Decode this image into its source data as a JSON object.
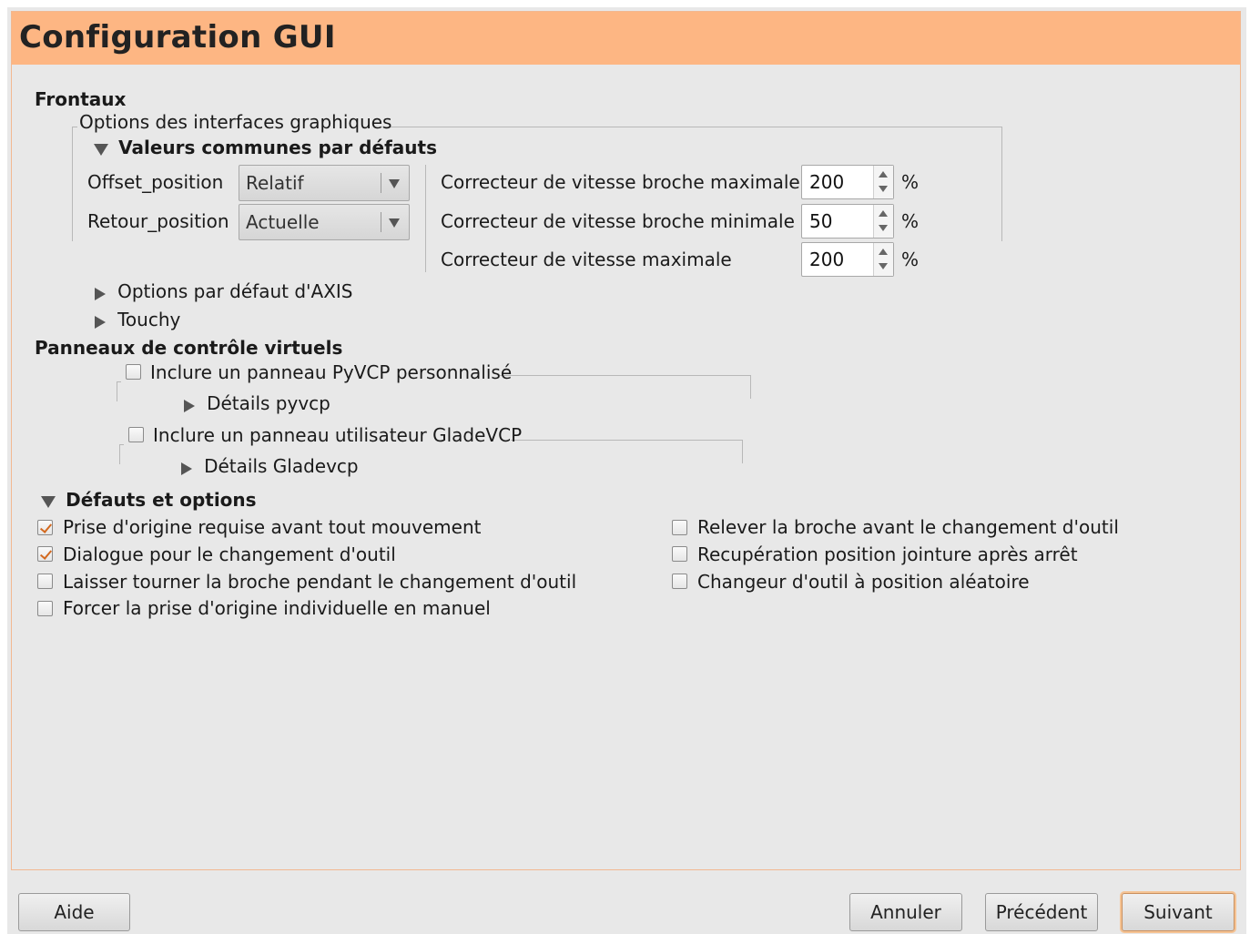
{
  "window": {
    "title": "Configuration GUI"
  },
  "frontaux": {
    "heading": "Frontaux",
    "frame_label": "Options des interfaces graphiques",
    "common_defaults": {
      "expander_label": "Valeurs communes par défauts",
      "offset_label": "Offset_position",
      "offset_value": "Relatif",
      "retour_label": "Retour_position",
      "retour_value": "Actuelle",
      "spindle_max_label": "Correcteur de vitesse broche maximale",
      "spindle_max_value": "200",
      "spindle_min_label": "Correcteur de vitesse broche minimale",
      "spindle_min_value": "50",
      "feed_max_label": "Correcteur de vitesse maximale",
      "feed_max_value": "200",
      "percent": "%"
    },
    "axis_label": "Options par défaut d'AXIS",
    "touchy_label": "Touchy"
  },
  "panneaux": {
    "heading": "Panneaux de contrôle virtuels",
    "pyvcp_label": "Inclure un panneau PyVCP personnalisé",
    "pyvcp_details": "Détails pyvcp",
    "glade_label": "Inclure un panneau utilisateur GladeVCP",
    "glade_details": "Détails Gladevcp"
  },
  "defaults": {
    "expander_label": "Défauts et options",
    "left": [
      {
        "label": "Prise d'origine requise avant tout mouvement",
        "checked": true
      },
      {
        "label": "Dialogue pour le changement d'outil",
        "checked": true
      },
      {
        "label": "Laisser tourner la broche pendant le changement d'outil",
        "checked": false
      },
      {
        "label": "Forcer la prise d'origine individuelle en manuel",
        "checked": false
      }
    ],
    "right": [
      {
        "label": "Relever la broche avant le changement d'outil",
        "checked": false
      },
      {
        "label": "Recupération position jointure après arrêt",
        "checked": false
      },
      {
        "label": "Changeur d'outil à position aléatoire",
        "checked": false
      }
    ]
  },
  "buttons": {
    "help": "Aide",
    "cancel": "Annuler",
    "previous": "Précédent",
    "next": "Suivant"
  },
  "colors": {
    "title_bar": "#fdb683",
    "check_mark": "#d3691f"
  }
}
